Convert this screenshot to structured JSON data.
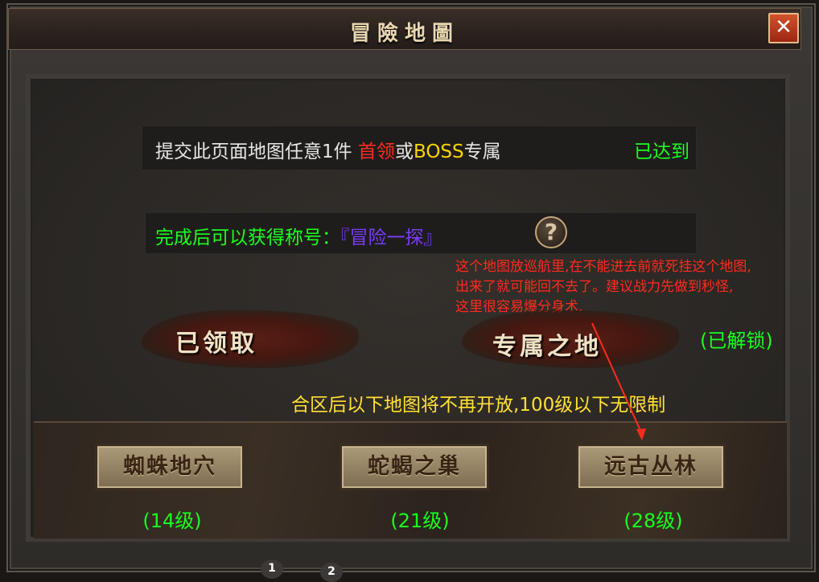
{
  "window": {
    "title": "冒險地圖",
    "close_label": "✕"
  },
  "requirement": {
    "prefix": "提交此页面地图任意1件 ",
    "highlight_red": "首领",
    "middle": "或",
    "highlight_yellow": "BOSS",
    "suffix": "专属",
    "status": "已达到"
  },
  "reward": {
    "label": "完成后可以获得称号：",
    "title": "『冒险一探』",
    "help_icon": "?"
  },
  "note": {
    "line1": "这个地图放巡航里,在不能进去前就死挂这个地图,",
    "line2": "出来了就可能回不去了。建议战力先做到秒怪,",
    "line3": "这里很容易爆分身术."
  },
  "banners": {
    "claimed": "已领取",
    "exclusive": "专属之地",
    "unlocked": "(已解锁)"
  },
  "merge_notice": "合区后以下地图将不再开放,100级以下无限制",
  "maps": [
    {
      "name": "蜘蛛地穴",
      "level": "(14级)"
    },
    {
      "name": "蛇蝎之巢",
      "level": "(21级)"
    },
    {
      "name": "远古丛林",
      "level": "(28级)"
    }
  ],
  "pagination": [
    "1",
    "2"
  ],
  "colors": {
    "green_text": "#19ff1e",
    "red_text": "#ff2a1e",
    "yellow_text": "#ffd400",
    "purple_text": "#7a3cff"
  }
}
